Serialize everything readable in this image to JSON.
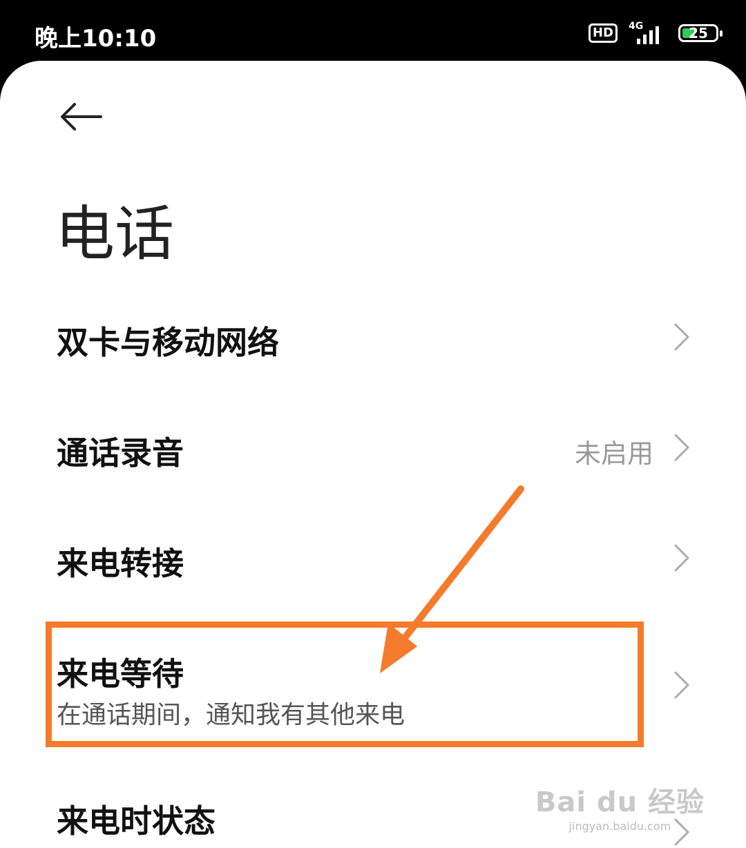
{
  "status_bar": {
    "time": "晚上10:10",
    "hd": "HD",
    "network": "4G",
    "battery": "25"
  },
  "header": {
    "back_icon": "arrow-left-icon",
    "title": "电话"
  },
  "settings": {
    "items": [
      {
        "label": "双卡与移动网络",
        "value": "",
        "sub": ""
      },
      {
        "label": "通话录音",
        "value": "未启用",
        "sub": ""
      },
      {
        "label": "来电转接",
        "value": "",
        "sub": ""
      },
      {
        "label": "来电等待",
        "value": "",
        "sub": "在通话期间，通知我有其他来电"
      },
      {
        "label": "来电时状态",
        "value": "",
        "sub": ""
      }
    ]
  },
  "annotation": {
    "color": "#f47b2b"
  },
  "watermark": {
    "main": "Bai du 经验",
    "url": "jingyan.baidu.com"
  }
}
